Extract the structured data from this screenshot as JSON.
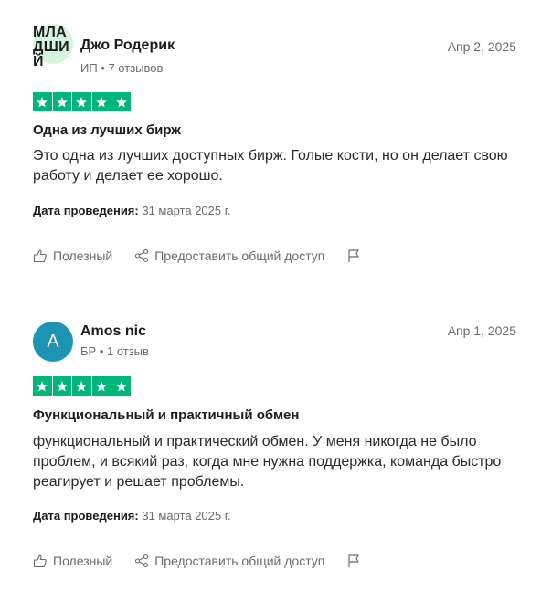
{
  "reviews": [
    {
      "avatar_text_lines": [
        "МЛА",
        "ДШИ",
        "Й"
      ],
      "author_name": "Джо Родерик",
      "author_meta": "ИП • 7 отзывов",
      "date": "Апр 2, 2025",
      "rating": 5,
      "title": "Одна из лучших бирж",
      "body": "Это одна из лучших доступных бирж. Голые кости, но он делает свою работу и делает ее хорошо.",
      "experience_label": "Дата проведения:",
      "experience_date": "31 марта 2025 г.",
      "useful_label": "Полезный",
      "share_label": "Предоставить общий доступ"
    },
    {
      "avatar_letter": "A",
      "author_name": "Amos nic",
      "author_meta": "БР • 1 отзыв",
      "date": "Апр 1, 2025",
      "rating": 5,
      "title": "Функциональный и практичный обмен",
      "body": "функциональный и практический обмен. У меня никогда не было проблем, и всякий раз, когда мне нужна поддержка, команда быстро реагирует и решает проблемы.",
      "experience_label": "Дата проведения:",
      "experience_date": "31 марта 2025 г.",
      "useful_label": "Полезный",
      "share_label": "Предоставить общий доступ"
    }
  ],
  "colors": {
    "star_green": "#00b67a",
    "avatar_mint": "#d6f5df",
    "avatar_teal": "#1d94b3",
    "muted_text": "#6b6b6b"
  },
  "icons": {
    "useful": "thumbs-up-icon",
    "share": "share-icon",
    "report": "flag-icon",
    "star": "star-icon"
  }
}
